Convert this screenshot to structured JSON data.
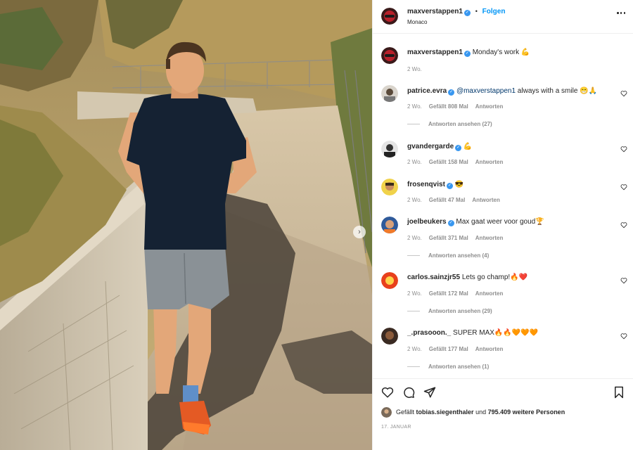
{
  "header": {
    "username": "maxverstappen1",
    "separator": "•",
    "follow_label": "Folgen",
    "location": "Monaco"
  },
  "caption": {
    "username": "maxverstappen1",
    "text": "Monday's work 💪",
    "age": "2 Wo."
  },
  "comments": [
    {
      "username": "patrice.evra",
      "verified": true,
      "mention": "@maxverstappen1",
      "text": " always with a smile 😁🙏",
      "age": "2 Wo.",
      "likes": "Gefällt 808 Mal",
      "reply": "Antworten",
      "replies": "Antworten ansehen (27)"
    },
    {
      "username": "gvandergarde",
      "verified": true,
      "mention": "",
      "text": "💪",
      "age": "2 Wo.",
      "likes": "Gefällt 158 Mal",
      "reply": "Antworten",
      "replies": ""
    },
    {
      "username": "frosenqvist",
      "verified": true,
      "mention": "",
      "text": "😎",
      "age": "2 Wo.",
      "likes": "Gefällt 47 Mal",
      "reply": "Antworten",
      "replies": ""
    },
    {
      "username": "joelbeukers",
      "verified": true,
      "mention": "",
      "text": "Max gaat weer voor goud🏆",
      "age": "2 Wo.",
      "likes": "Gefällt 371 Mal",
      "reply": "Antworten",
      "replies": "Antworten ansehen (4)"
    },
    {
      "username": "carlos.sainzjr55",
      "verified": false,
      "mention": "",
      "text": "Lets go champ!🔥❤️",
      "age": "2 Wo.",
      "likes": "Gefällt 172 Mal",
      "reply": "Antworten",
      "replies": "Antworten ansehen (29)"
    },
    {
      "username": "_.prasooon._",
      "verified": false,
      "mention": "",
      "text": "SUPER MAX🔥🔥🧡🧡🧡",
      "age": "2 Wo.",
      "likes": "Gefällt 177 Mal",
      "reply": "Antworten",
      "replies": "Antworten ansehen (1)"
    }
  ],
  "likes": {
    "prefix": "Gefällt",
    "user": "tobias.siegenthaler",
    "middle": "und",
    "count": "795.409 weitere Personen"
  },
  "date": "17. JANUAR",
  "icons": {
    "like": "heart-icon",
    "comment": "comment-icon",
    "share": "paper-plane-icon",
    "save": "bookmark-icon",
    "more": "more-options-icon",
    "next": "chevron-right-icon",
    "verified": "verified-badge-icon"
  },
  "colors": {
    "accent": "#0095f6",
    "verified": "#3897f0",
    "muted": "#8e8e8e",
    "text": "#262626"
  }
}
